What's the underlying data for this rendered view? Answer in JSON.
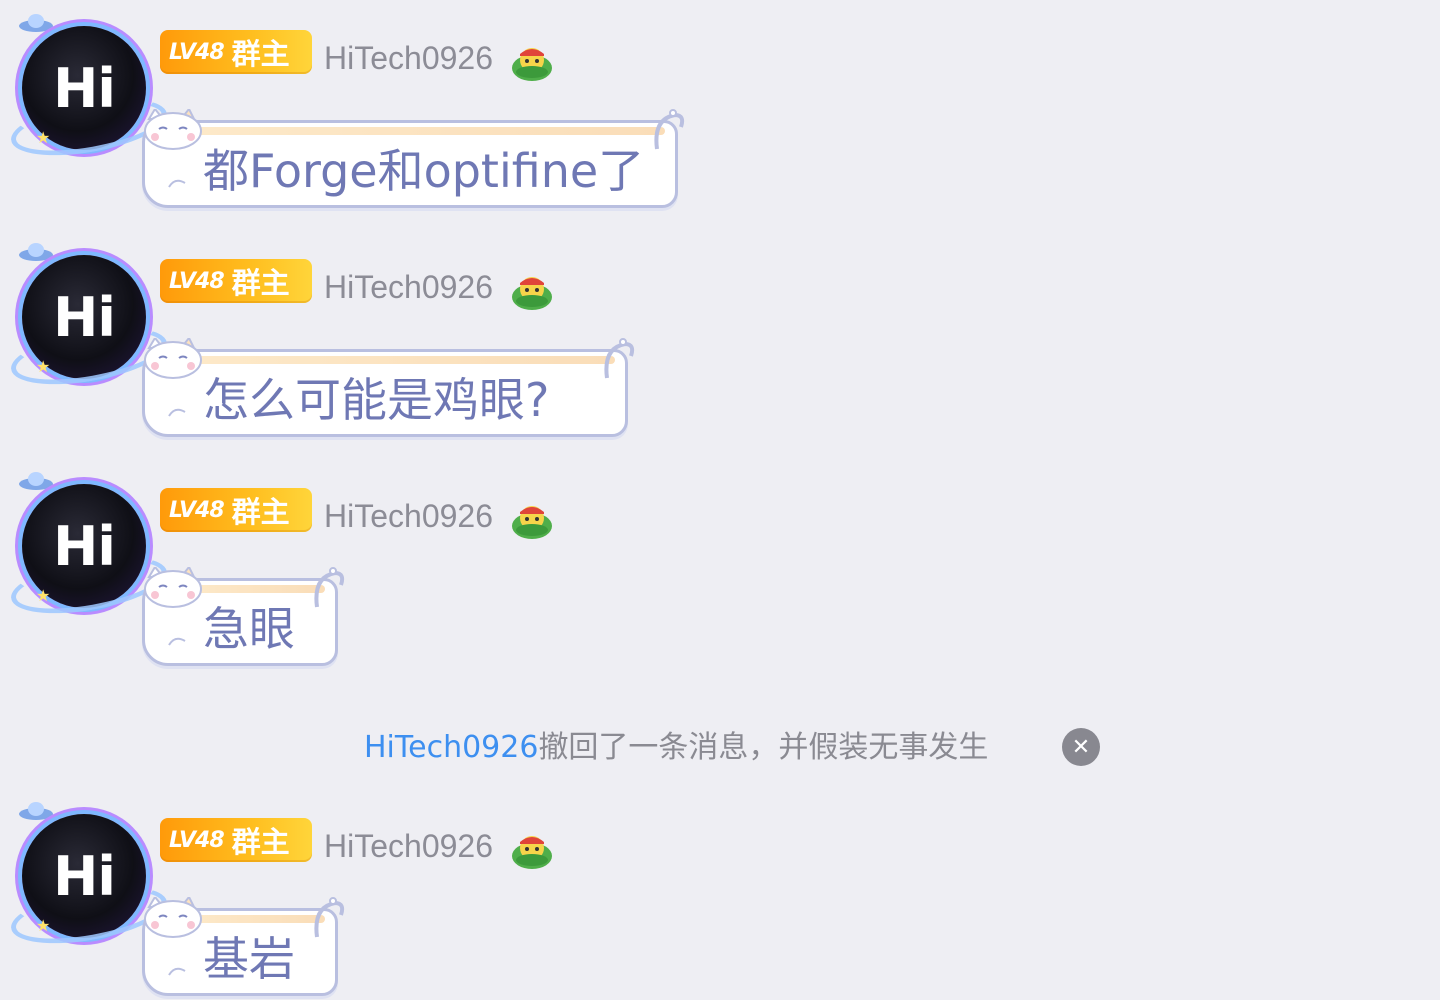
{
  "messages": [
    {
      "avatar_text": "Hi",
      "level": "LV48",
      "role": "群主",
      "nickname": "HiTech0926",
      "text": "都Forge和optifine了"
    },
    {
      "avatar_text": "Hi",
      "level": "LV48",
      "role": "群主",
      "nickname": "HiTech0926",
      "text": "怎么可能是鸡眼?"
    },
    {
      "avatar_text": "Hi",
      "level": "LV48",
      "role": "群主",
      "nickname": "HiTech0926",
      "text": "急眼"
    },
    {
      "avatar_text": "Hi",
      "level": "LV48",
      "role": "群主",
      "nickname": "HiTech0926",
      "text": "基岩"
    }
  ],
  "system_notice": {
    "name": "HiTech0926",
    "text": "撤回了一条消息，并假装无事发生",
    "close_icon": "close-icon"
  },
  "colors": {
    "background": "#eeeef3",
    "badge": "#ffb000",
    "bubble_text": "#6f78b4",
    "nickname": "#8c8c96",
    "system_name": "#3d8ff0",
    "system_text": "#8a8a92"
  }
}
